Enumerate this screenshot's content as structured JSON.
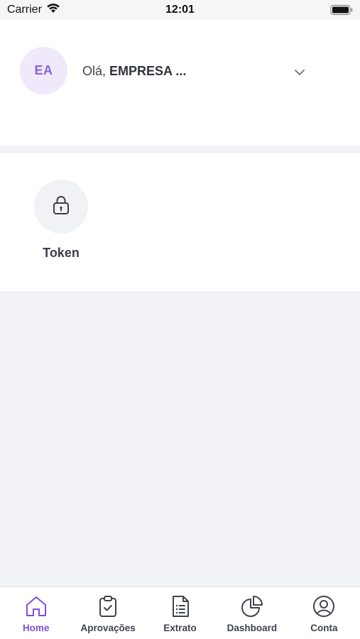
{
  "status_bar": {
    "carrier": "Carrier",
    "time": "12:01"
  },
  "header": {
    "avatar_initials": "EA",
    "greeting_prefix": "Olá, ",
    "company_name": "EMPRESA ..."
  },
  "shortcuts": [
    {
      "label": "Token",
      "icon": "lock-icon"
    }
  ],
  "tabs": [
    {
      "label": "Home",
      "icon": "home-icon",
      "active": true
    },
    {
      "label": "Aprovações",
      "icon": "clipboard-check-icon",
      "active": false
    },
    {
      "label": "Extrato",
      "icon": "document-list-icon",
      "active": false
    },
    {
      "label": "Dashboard",
      "icon": "pie-chart-icon",
      "active": false
    },
    {
      "label": "Conta",
      "icon": "user-circle-icon",
      "active": false
    }
  ],
  "colors": {
    "accent": "#7c4fd9",
    "avatar_bg": "#efe9fb",
    "page_bg": "#f2f3f7",
    "card_bg": "#ffffff"
  }
}
